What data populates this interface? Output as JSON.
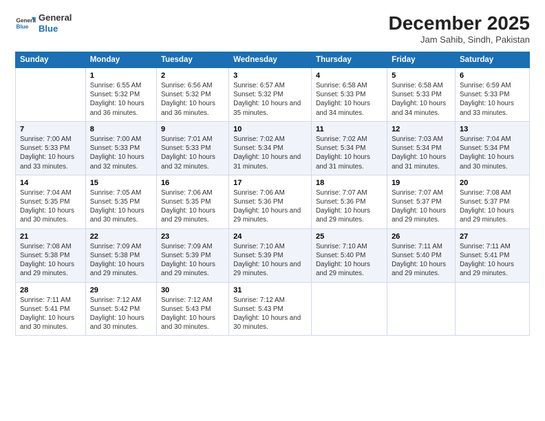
{
  "header": {
    "logo_general": "General",
    "logo_blue": "Blue",
    "title": "December 2025",
    "subtitle": "Jam Sahib, Sindh, Pakistan"
  },
  "calendar": {
    "headers": [
      "Sunday",
      "Monday",
      "Tuesday",
      "Wednesday",
      "Thursday",
      "Friday",
      "Saturday"
    ],
    "rows": [
      [
        {
          "day": "",
          "info": ""
        },
        {
          "day": "1",
          "info": "Sunrise: 6:55 AM\nSunset: 5:32 PM\nDaylight: 10 hours\nand 36 minutes."
        },
        {
          "day": "2",
          "info": "Sunrise: 6:56 AM\nSunset: 5:32 PM\nDaylight: 10 hours\nand 36 minutes."
        },
        {
          "day": "3",
          "info": "Sunrise: 6:57 AM\nSunset: 5:32 PM\nDaylight: 10 hours\nand 35 minutes."
        },
        {
          "day": "4",
          "info": "Sunrise: 6:58 AM\nSunset: 5:33 PM\nDaylight: 10 hours\nand 34 minutes."
        },
        {
          "day": "5",
          "info": "Sunrise: 6:58 AM\nSunset: 5:33 PM\nDaylight: 10 hours\nand 34 minutes."
        },
        {
          "day": "6",
          "info": "Sunrise: 6:59 AM\nSunset: 5:33 PM\nDaylight: 10 hours\nand 33 minutes."
        }
      ],
      [
        {
          "day": "7",
          "info": "Sunrise: 7:00 AM\nSunset: 5:33 PM\nDaylight: 10 hours\nand 33 minutes."
        },
        {
          "day": "8",
          "info": "Sunrise: 7:00 AM\nSunset: 5:33 PM\nDaylight: 10 hours\nand 32 minutes."
        },
        {
          "day": "9",
          "info": "Sunrise: 7:01 AM\nSunset: 5:33 PM\nDaylight: 10 hours\nand 32 minutes."
        },
        {
          "day": "10",
          "info": "Sunrise: 7:02 AM\nSunset: 5:34 PM\nDaylight: 10 hours\nand 31 minutes."
        },
        {
          "day": "11",
          "info": "Sunrise: 7:02 AM\nSunset: 5:34 PM\nDaylight: 10 hours\nand 31 minutes."
        },
        {
          "day": "12",
          "info": "Sunrise: 7:03 AM\nSunset: 5:34 PM\nDaylight: 10 hours\nand 31 minutes."
        },
        {
          "day": "13",
          "info": "Sunrise: 7:04 AM\nSunset: 5:34 PM\nDaylight: 10 hours\nand 30 minutes."
        }
      ],
      [
        {
          "day": "14",
          "info": "Sunrise: 7:04 AM\nSunset: 5:35 PM\nDaylight: 10 hours\nand 30 minutes."
        },
        {
          "day": "15",
          "info": "Sunrise: 7:05 AM\nSunset: 5:35 PM\nDaylight: 10 hours\nand 30 minutes."
        },
        {
          "day": "16",
          "info": "Sunrise: 7:06 AM\nSunset: 5:35 PM\nDaylight: 10 hours\nand 29 minutes."
        },
        {
          "day": "17",
          "info": "Sunrise: 7:06 AM\nSunset: 5:36 PM\nDaylight: 10 hours\nand 29 minutes."
        },
        {
          "day": "18",
          "info": "Sunrise: 7:07 AM\nSunset: 5:36 PM\nDaylight: 10 hours\nand 29 minutes."
        },
        {
          "day": "19",
          "info": "Sunrise: 7:07 AM\nSunset: 5:37 PM\nDaylight: 10 hours\nand 29 minutes."
        },
        {
          "day": "20",
          "info": "Sunrise: 7:08 AM\nSunset: 5:37 PM\nDaylight: 10 hours\nand 29 minutes."
        }
      ],
      [
        {
          "day": "21",
          "info": "Sunrise: 7:08 AM\nSunset: 5:38 PM\nDaylight: 10 hours\nand 29 minutes."
        },
        {
          "day": "22",
          "info": "Sunrise: 7:09 AM\nSunset: 5:38 PM\nDaylight: 10 hours\nand 29 minutes."
        },
        {
          "day": "23",
          "info": "Sunrise: 7:09 AM\nSunset: 5:39 PM\nDaylight: 10 hours\nand 29 minutes."
        },
        {
          "day": "24",
          "info": "Sunrise: 7:10 AM\nSunset: 5:39 PM\nDaylight: 10 hours\nand 29 minutes."
        },
        {
          "day": "25",
          "info": "Sunrise: 7:10 AM\nSunset: 5:40 PM\nDaylight: 10 hours\nand 29 minutes."
        },
        {
          "day": "26",
          "info": "Sunrise: 7:11 AM\nSunset: 5:40 PM\nDaylight: 10 hours\nand 29 minutes."
        },
        {
          "day": "27",
          "info": "Sunrise: 7:11 AM\nSunset: 5:41 PM\nDaylight: 10 hours\nand 29 minutes."
        }
      ],
      [
        {
          "day": "28",
          "info": "Sunrise: 7:11 AM\nSunset: 5:41 PM\nDaylight: 10 hours\nand 30 minutes."
        },
        {
          "day": "29",
          "info": "Sunrise: 7:12 AM\nSunset: 5:42 PM\nDaylight: 10 hours\nand 30 minutes."
        },
        {
          "day": "30",
          "info": "Sunrise: 7:12 AM\nSunset: 5:43 PM\nDaylight: 10 hours\nand 30 minutes."
        },
        {
          "day": "31",
          "info": "Sunrise: 7:12 AM\nSunset: 5:43 PM\nDaylight: 10 hours\nand 30 minutes."
        },
        {
          "day": "",
          "info": ""
        },
        {
          "day": "",
          "info": ""
        },
        {
          "day": "",
          "info": ""
        }
      ]
    ]
  }
}
